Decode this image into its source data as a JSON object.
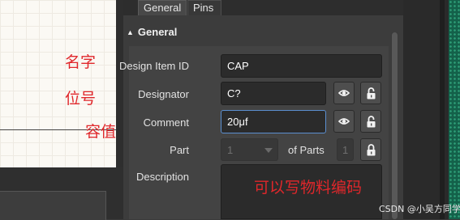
{
  "tabs": [
    {
      "label": "General"
    },
    {
      "label": "Pins"
    }
  ],
  "section": {
    "title": "General"
  },
  "properties": {
    "design_item_id": {
      "label": "Design Item ID",
      "value": "CAP"
    },
    "designator": {
      "label": "Designator",
      "value": "C?"
    },
    "comment": {
      "label": "Comment",
      "value": "20μf"
    },
    "part": {
      "label": "Part",
      "value": "1",
      "of_parts_label": "of Parts",
      "of_parts_value": "1"
    },
    "description": {
      "label": "Description",
      "value": ""
    }
  },
  "annotations": {
    "name": "名字",
    "designator": "位号",
    "capacitance": "容值",
    "description": "可以写物料编码"
  },
  "watermark": "CSDN @小吴方同学",
  "colors": {
    "annotation": "#e0272b",
    "focus_border": "#5b8fd0",
    "panel_bg": "#3c3c3c"
  }
}
